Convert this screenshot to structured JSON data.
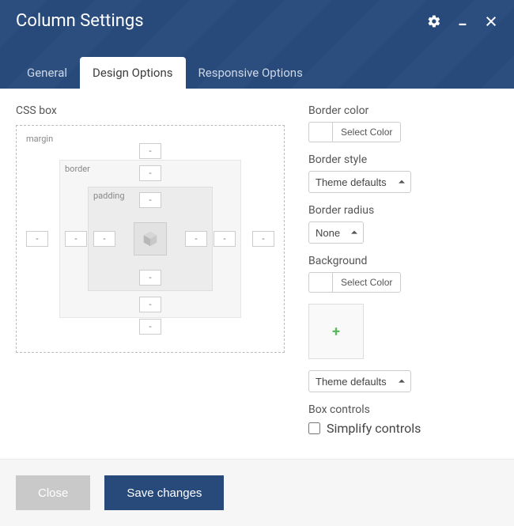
{
  "header": {
    "title": "Column Settings",
    "icons": {
      "settings": "gear-icon",
      "minimize": "minimize-icon",
      "close": "close-icon"
    }
  },
  "tabs": [
    {
      "id": "general",
      "label": "General",
      "active": false
    },
    {
      "id": "design",
      "label": "Design Options",
      "active": true
    },
    {
      "id": "responsive",
      "label": "Responsive Options",
      "active": false
    }
  ],
  "cssbox": {
    "section_label": "CSS box",
    "margin_label": "margin",
    "border_label": "border",
    "padding_label": "padding",
    "placeholder": "-",
    "values": {
      "margin": {
        "top": "",
        "right": "",
        "bottom": "",
        "left": ""
      },
      "border": {
        "top": "",
        "right": "",
        "bottom": "",
        "left": ""
      },
      "padding": {
        "top": "",
        "right": "",
        "bottom": "",
        "left": ""
      }
    }
  },
  "fields": {
    "border_color": {
      "label": "Border color",
      "button": "Select Color"
    },
    "border_style": {
      "label": "Border style",
      "value": "Theme defaults"
    },
    "border_radius": {
      "label": "Border radius",
      "value": "None"
    },
    "background": {
      "label": "Background",
      "button": "Select Color"
    },
    "bg_select": {
      "value": "Theme defaults"
    },
    "box_controls": {
      "label": "Box controls",
      "checkbox_label": "Simplify controls",
      "checked": false
    }
  },
  "footer": {
    "close": "Close",
    "save": "Save changes"
  }
}
